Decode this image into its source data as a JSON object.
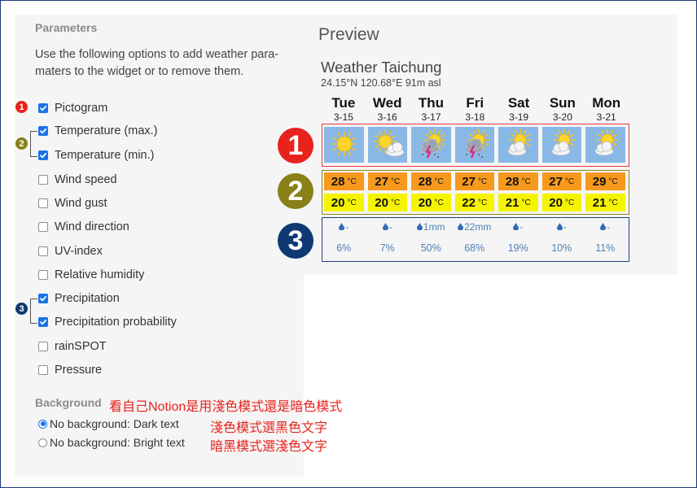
{
  "parameters": {
    "title": "Parameters",
    "description": "Use the following options to add weather parameters to the widget or to remove them.",
    "options": [
      {
        "label": "Pictogram",
        "checked": true
      },
      {
        "label": "Temperature (max.)",
        "checked": true
      },
      {
        "label": "Temperature (min.)",
        "checked": true
      },
      {
        "label": "Wind speed",
        "checked": false
      },
      {
        "label": "Wind gust",
        "checked": false
      },
      {
        "label": "Wind direction",
        "checked": false
      },
      {
        "label": "UV-index",
        "checked": false
      },
      {
        "label": "Relative humidity",
        "checked": false
      },
      {
        "label": "Precipitation",
        "checked": true
      },
      {
        "label": "Precipitation probability",
        "checked": true
      },
      {
        "label": "rainSPOT",
        "checked": false
      },
      {
        "label": "Pressure",
        "checked": false
      }
    ]
  },
  "background": {
    "title": "Background",
    "options": [
      {
        "label": "No background: Dark text",
        "selected": true
      },
      {
        "label": "No background: Bright text",
        "selected": false
      }
    ]
  },
  "annotations": {
    "note1": "看自己Notion是用淺色模式還是暗色模式",
    "note2": "淺色模式選黑色文字",
    "note3": "暗黑模式選淺色文字",
    "badge1": "1",
    "badge2": "2",
    "badge3": "3",
    "colors": {
      "red": "#e8231d",
      "olive": "#888018",
      "navy": "#0f3973"
    }
  },
  "preview": {
    "title": "Preview",
    "city": "Weather Taichung",
    "coords": "24.15°N 120.68°E 91m asl",
    "temp_unit": "°C",
    "days": [
      {
        "name": "Tue",
        "date": "3-15",
        "icon": "sun-icon",
        "max": "28",
        "min": "20",
        "precip": "-",
        "prob": "6%"
      },
      {
        "name": "Wed",
        "date": "3-16",
        "icon": "sun-cloud-icon",
        "max": "27",
        "min": "20",
        "precip": "-",
        "prob": "7%"
      },
      {
        "name": "Thu",
        "date": "3-17",
        "icon": "thunderstorm-icon",
        "max": "28",
        "min": "20",
        "precip": "1mm",
        "prob": "50%"
      },
      {
        "name": "Fri",
        "date": "3-18",
        "icon": "thunderstorm-icon",
        "max": "27",
        "min": "22",
        "precip": "22mm",
        "prob": "68%"
      },
      {
        "name": "Sat",
        "date": "3-19",
        "icon": "partly-cloudy-icon",
        "max": "28",
        "min": "21",
        "precip": "-",
        "prob": "19%"
      },
      {
        "name": "Sun",
        "date": "3-20",
        "icon": "partly-cloudy-icon",
        "max": "27",
        "min": "20",
        "precip": "-",
        "prob": "10%"
      },
      {
        "name": "Mon",
        "date": "3-21",
        "icon": "partly-cloudy-icon",
        "max": "29",
        "min": "21",
        "precip": "-",
        "prob": "11%"
      }
    ],
    "colors": {
      "max_temp_bg": "#f6991d",
      "min_temp_bg": "#f4f400",
      "picto_bg": "#8ab8e6",
      "precip_text": "#4f7fb5"
    }
  }
}
